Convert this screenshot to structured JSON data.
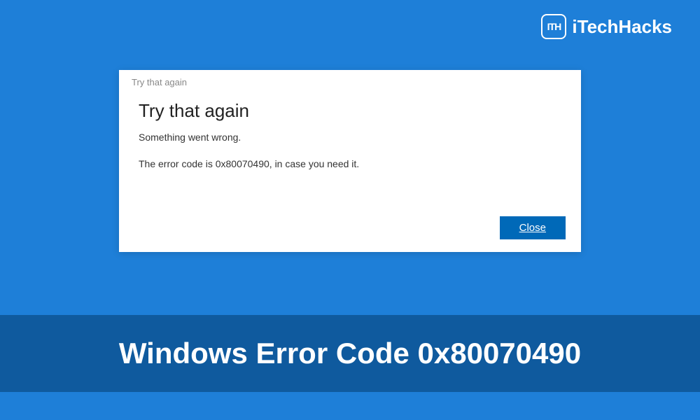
{
  "logo": {
    "badge_text": "ITH",
    "brand_text": "iTechHacks"
  },
  "dialog": {
    "window_title": "Try that again",
    "heading": "Try that again",
    "subtitle": "Something went wrong.",
    "message": "The error code is 0x80070490, in case you need it.",
    "close_label": "Close"
  },
  "banner": {
    "text": "Windows Error Code 0x80070490"
  }
}
